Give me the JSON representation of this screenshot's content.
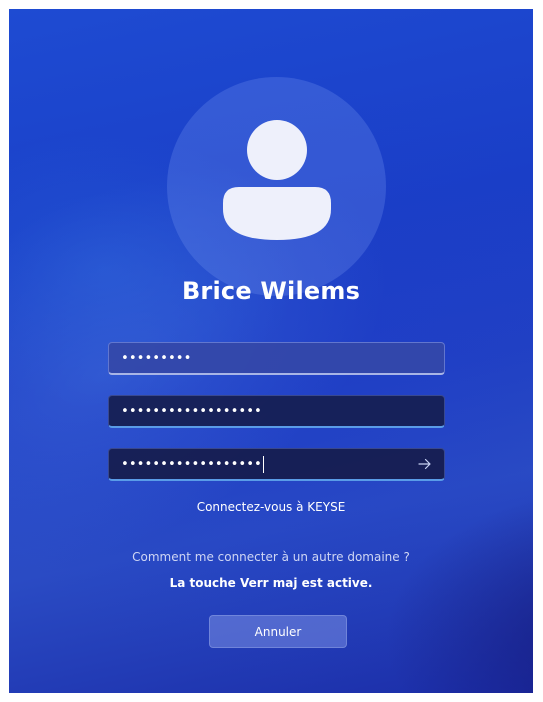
{
  "user": {
    "name": "Brice Wilems",
    "avatar_icon": "user-silhouette-icon"
  },
  "fields": {
    "field1_value": "•••••••••",
    "field2_value": "••••••••••••••••••",
    "field3_value": "••••••••••••••••••",
    "submit_icon": "arrow-right-icon"
  },
  "messages": {
    "connect_to": "Connectez-vous à KEYSE",
    "other_domain_link": "Comment me connecter à un autre domaine ?",
    "capslock_warning": "La touche Verr maj est active."
  },
  "buttons": {
    "cancel_label": "Annuler"
  },
  "colors": {
    "background_primary": "#1e4bd2",
    "avatar_circle": "#5a72d8",
    "avatar_glyph": "#eef0fb",
    "focus_underline": "#5a9ce8"
  }
}
